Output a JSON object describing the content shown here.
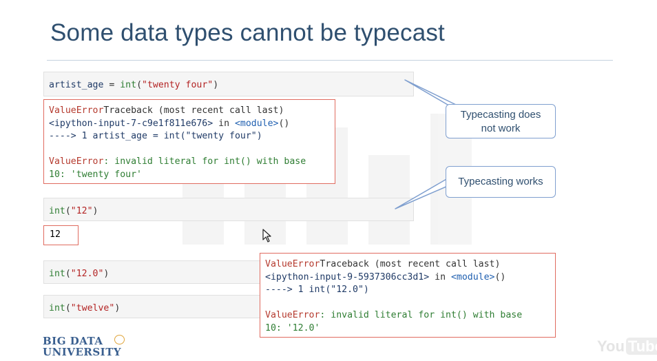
{
  "title": "Some data types cannot be typecast",
  "cells": {
    "cell1": {
      "var": "artist_age",
      "op": " = ",
      "func": "int",
      "open": "(",
      "str": "\"twenty four\"",
      "close": ")"
    },
    "cell2": {
      "func": "int",
      "open": "(",
      "str": "\"12\"",
      "close": ")"
    },
    "cell2_output": "12",
    "cell3": {
      "func": "int",
      "open": "(",
      "str": "\"12.0\"",
      "close": ")"
    },
    "cell4": {
      "func": "int",
      "open": "(",
      "str": "\"twelve\"",
      "close": ")"
    }
  },
  "error1": {
    "line1_err": "ValueError",
    "line1_rest": "Traceback (most recent call last)",
    "line2_input": "<ipython-input-7-c9e1f811e676>",
    "line2_in": " in ",
    "line2_module": "<module>",
    "line2_paren": "()",
    "line3_arrow": "----> 1 ",
    "line3_code": "artist_age = int(\"twenty four\")",
    "line5_err": "ValueError",
    "line5_msg": ": invalid literal for int() with base",
    "line6_msg": "10: 'twenty four'"
  },
  "error2": {
    "line1_err": "ValueError",
    "line1_rest": "Traceback (most recent call last)",
    "line2_input": "<ipython-input-9-5937306cc3d1>",
    "line2_in": " in ",
    "line2_module": "<module>",
    "line2_paren": "()",
    "line3_arrow": "----> 1 ",
    "line3_code": "int(\"12.0\")",
    "line5_err": "ValueError",
    "line5_msg": ": invalid literal for int() with base",
    "line6_msg": "10: '12.0'"
  },
  "callouts": {
    "does_not_work_line1": "Typecasting does",
    "does_not_work_line2": "not work",
    "works": "Typecasting works"
  },
  "logo": {
    "line1": "BIG DATA",
    "line2": "UNIVERSITY"
  },
  "youtube": {
    "you": "You",
    "tube": "Tube"
  },
  "colors": {
    "title": "#2f4f6f",
    "error_border": "#e06b5f",
    "callout_border": "#7f9fcf"
  }
}
